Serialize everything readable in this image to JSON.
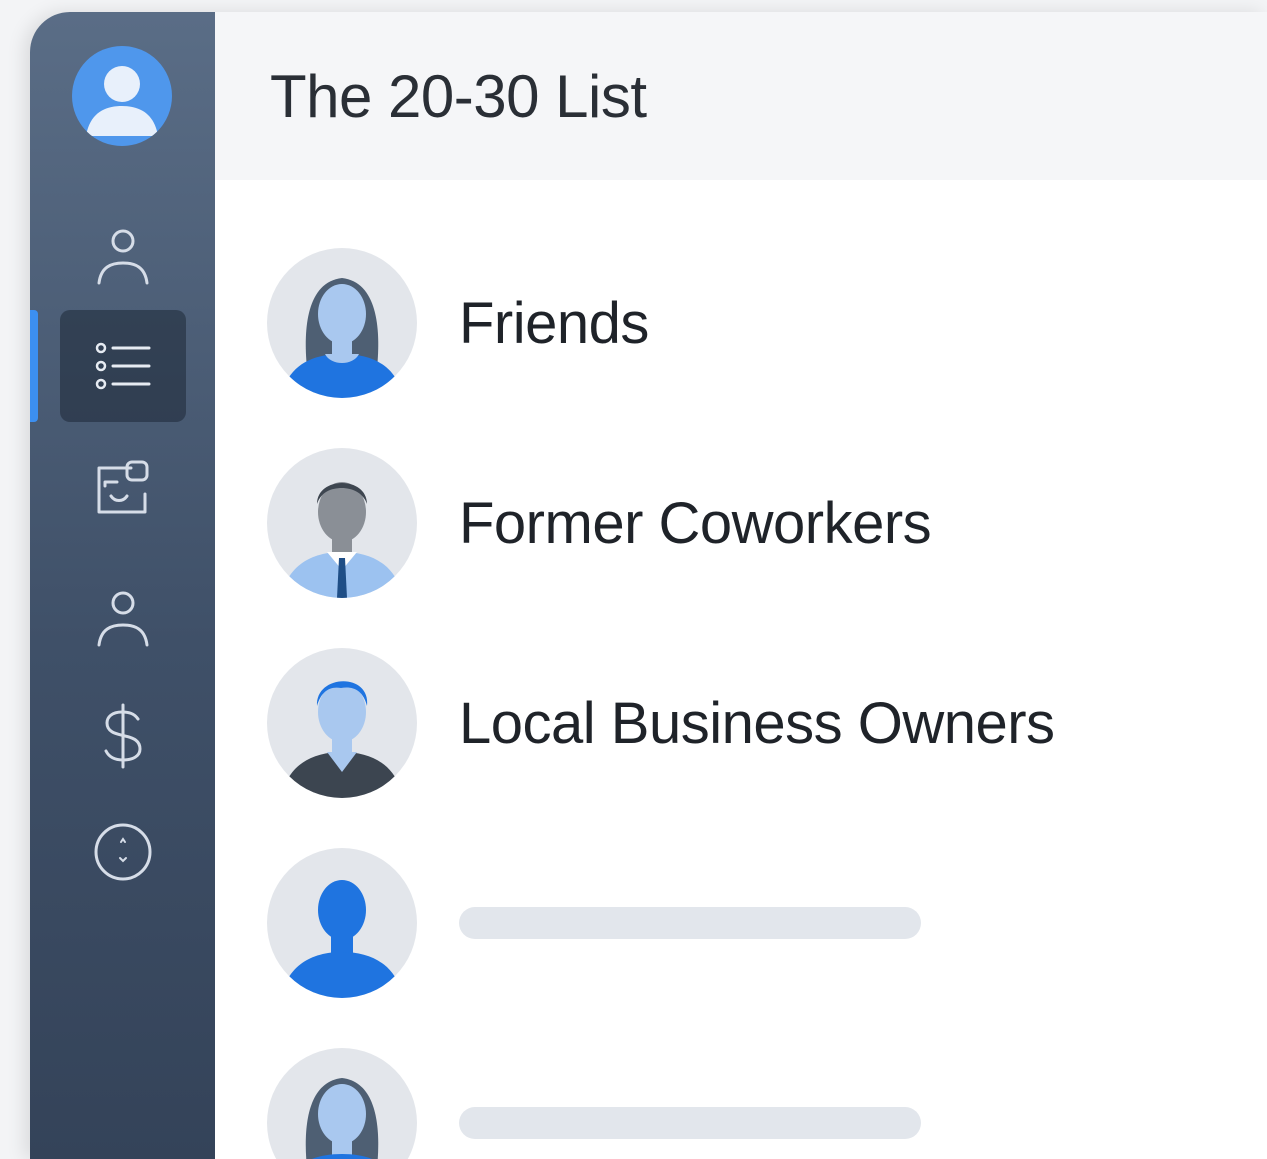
{
  "header": {
    "title": "The 20-30 List"
  },
  "sidebar": {
    "profile_icon": "user-avatar-icon",
    "items": [
      {
        "id": "contacts",
        "icon": "person-icon",
        "active": false
      },
      {
        "id": "lists",
        "icon": "list-icon",
        "active": true
      },
      {
        "id": "inbox",
        "icon": "inbox-icon",
        "active": false
      },
      {
        "id": "people",
        "icon": "person-icon",
        "active": false
      },
      {
        "id": "payments",
        "icon": "dollar-icon",
        "active": false
      },
      {
        "id": "info",
        "icon": "info-circle-icon",
        "active": false
      }
    ],
    "accent": "#3c8ff0"
  },
  "lists": [
    {
      "label": "Friends",
      "avatar": "woman-avatar"
    },
    {
      "label": "Former Coworkers",
      "avatar": "man-tie-avatar"
    },
    {
      "label": "Local Business Owners",
      "avatar": "man-suit-avatar"
    },
    {
      "label": "",
      "avatar": "person-silhouette-avatar"
    },
    {
      "label": "",
      "avatar": "woman-avatar"
    }
  ]
}
